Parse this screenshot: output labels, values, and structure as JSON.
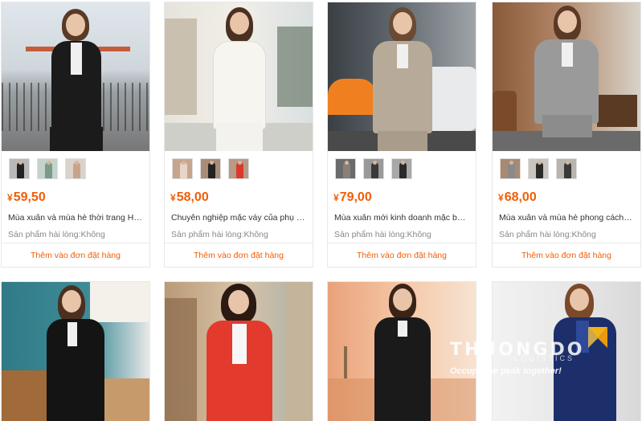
{
  "products": [
    {
      "price": "59,50",
      "currency": "¥",
      "title": "Mùa xuân và mùa hè thời trang Hàn ...",
      "satisfaction": "Sản phẩm hài lòng:Không",
      "add_label": "Thêm vào đơn đặt hàng",
      "thumb_colors": [
        "#222222",
        "#7a9a8a",
        "#c9a48a"
      ]
    },
    {
      "price": "58,00",
      "currency": "¥",
      "title": "Chuyên nghiệp mặc váy của phụ nữ ...",
      "satisfaction": "Sản phẩm hài lòng:Không",
      "add_label": "Thêm vào đơn đặt hàng",
      "thumb_colors": [
        "#e8d5c8",
        "#222222",
        "#d93a2a"
      ]
    },
    {
      "price": "79,00",
      "currency": "¥",
      "title": "Mùa xuân mới kinh doanh mặc bộ đồ...",
      "satisfaction": "Sản phẩm hài lòng:Không",
      "add_label": "Thêm vào đơn đặt hàng",
      "thumb_colors": [
        "#8a8078",
        "#3a3a3a",
        "#2a2a2a"
      ]
    },
    {
      "price": "68,00",
      "currency": "¥",
      "title": "Mùa xuân và mùa hè phong cách Hà...",
      "satisfaction": "Sản phẩm hài lòng:Không",
      "add_label": "Thêm vào đơn đặt hàng",
      "thumb_colors": [
        "#8a8a8a",
        "#2a2a2a",
        "#3a3a3a"
      ]
    }
  ],
  "watermark": {
    "brand": "THUONGDO",
    "sub": "LOGISTICS",
    "slogan": "Occupy the peak together!"
  },
  "colors": {
    "accent": "#f25d04",
    "border": "#e8e8e8"
  }
}
